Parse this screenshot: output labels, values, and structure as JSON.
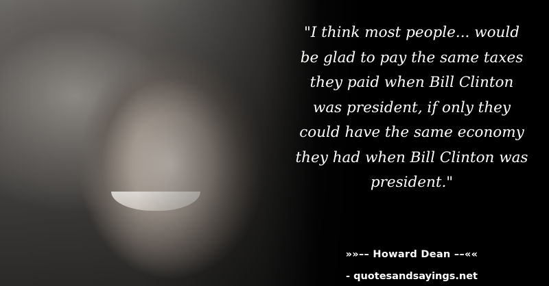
{
  "quote": {
    "lines": [
      "\"I think most people... would",
      "be glad to pay the same taxes",
      "they paid when Bill Clinton",
      "was president, if only they",
      "could have the same economy",
      "they had when Bill Clinton was",
      "president.\""
    ]
  },
  "attribution": {
    "author_line": "»»–– Howard Dean ––««",
    "source": "- quotesandsayings.net"
  },
  "colors": {
    "background": "#000000",
    "text": "#ffffff"
  }
}
